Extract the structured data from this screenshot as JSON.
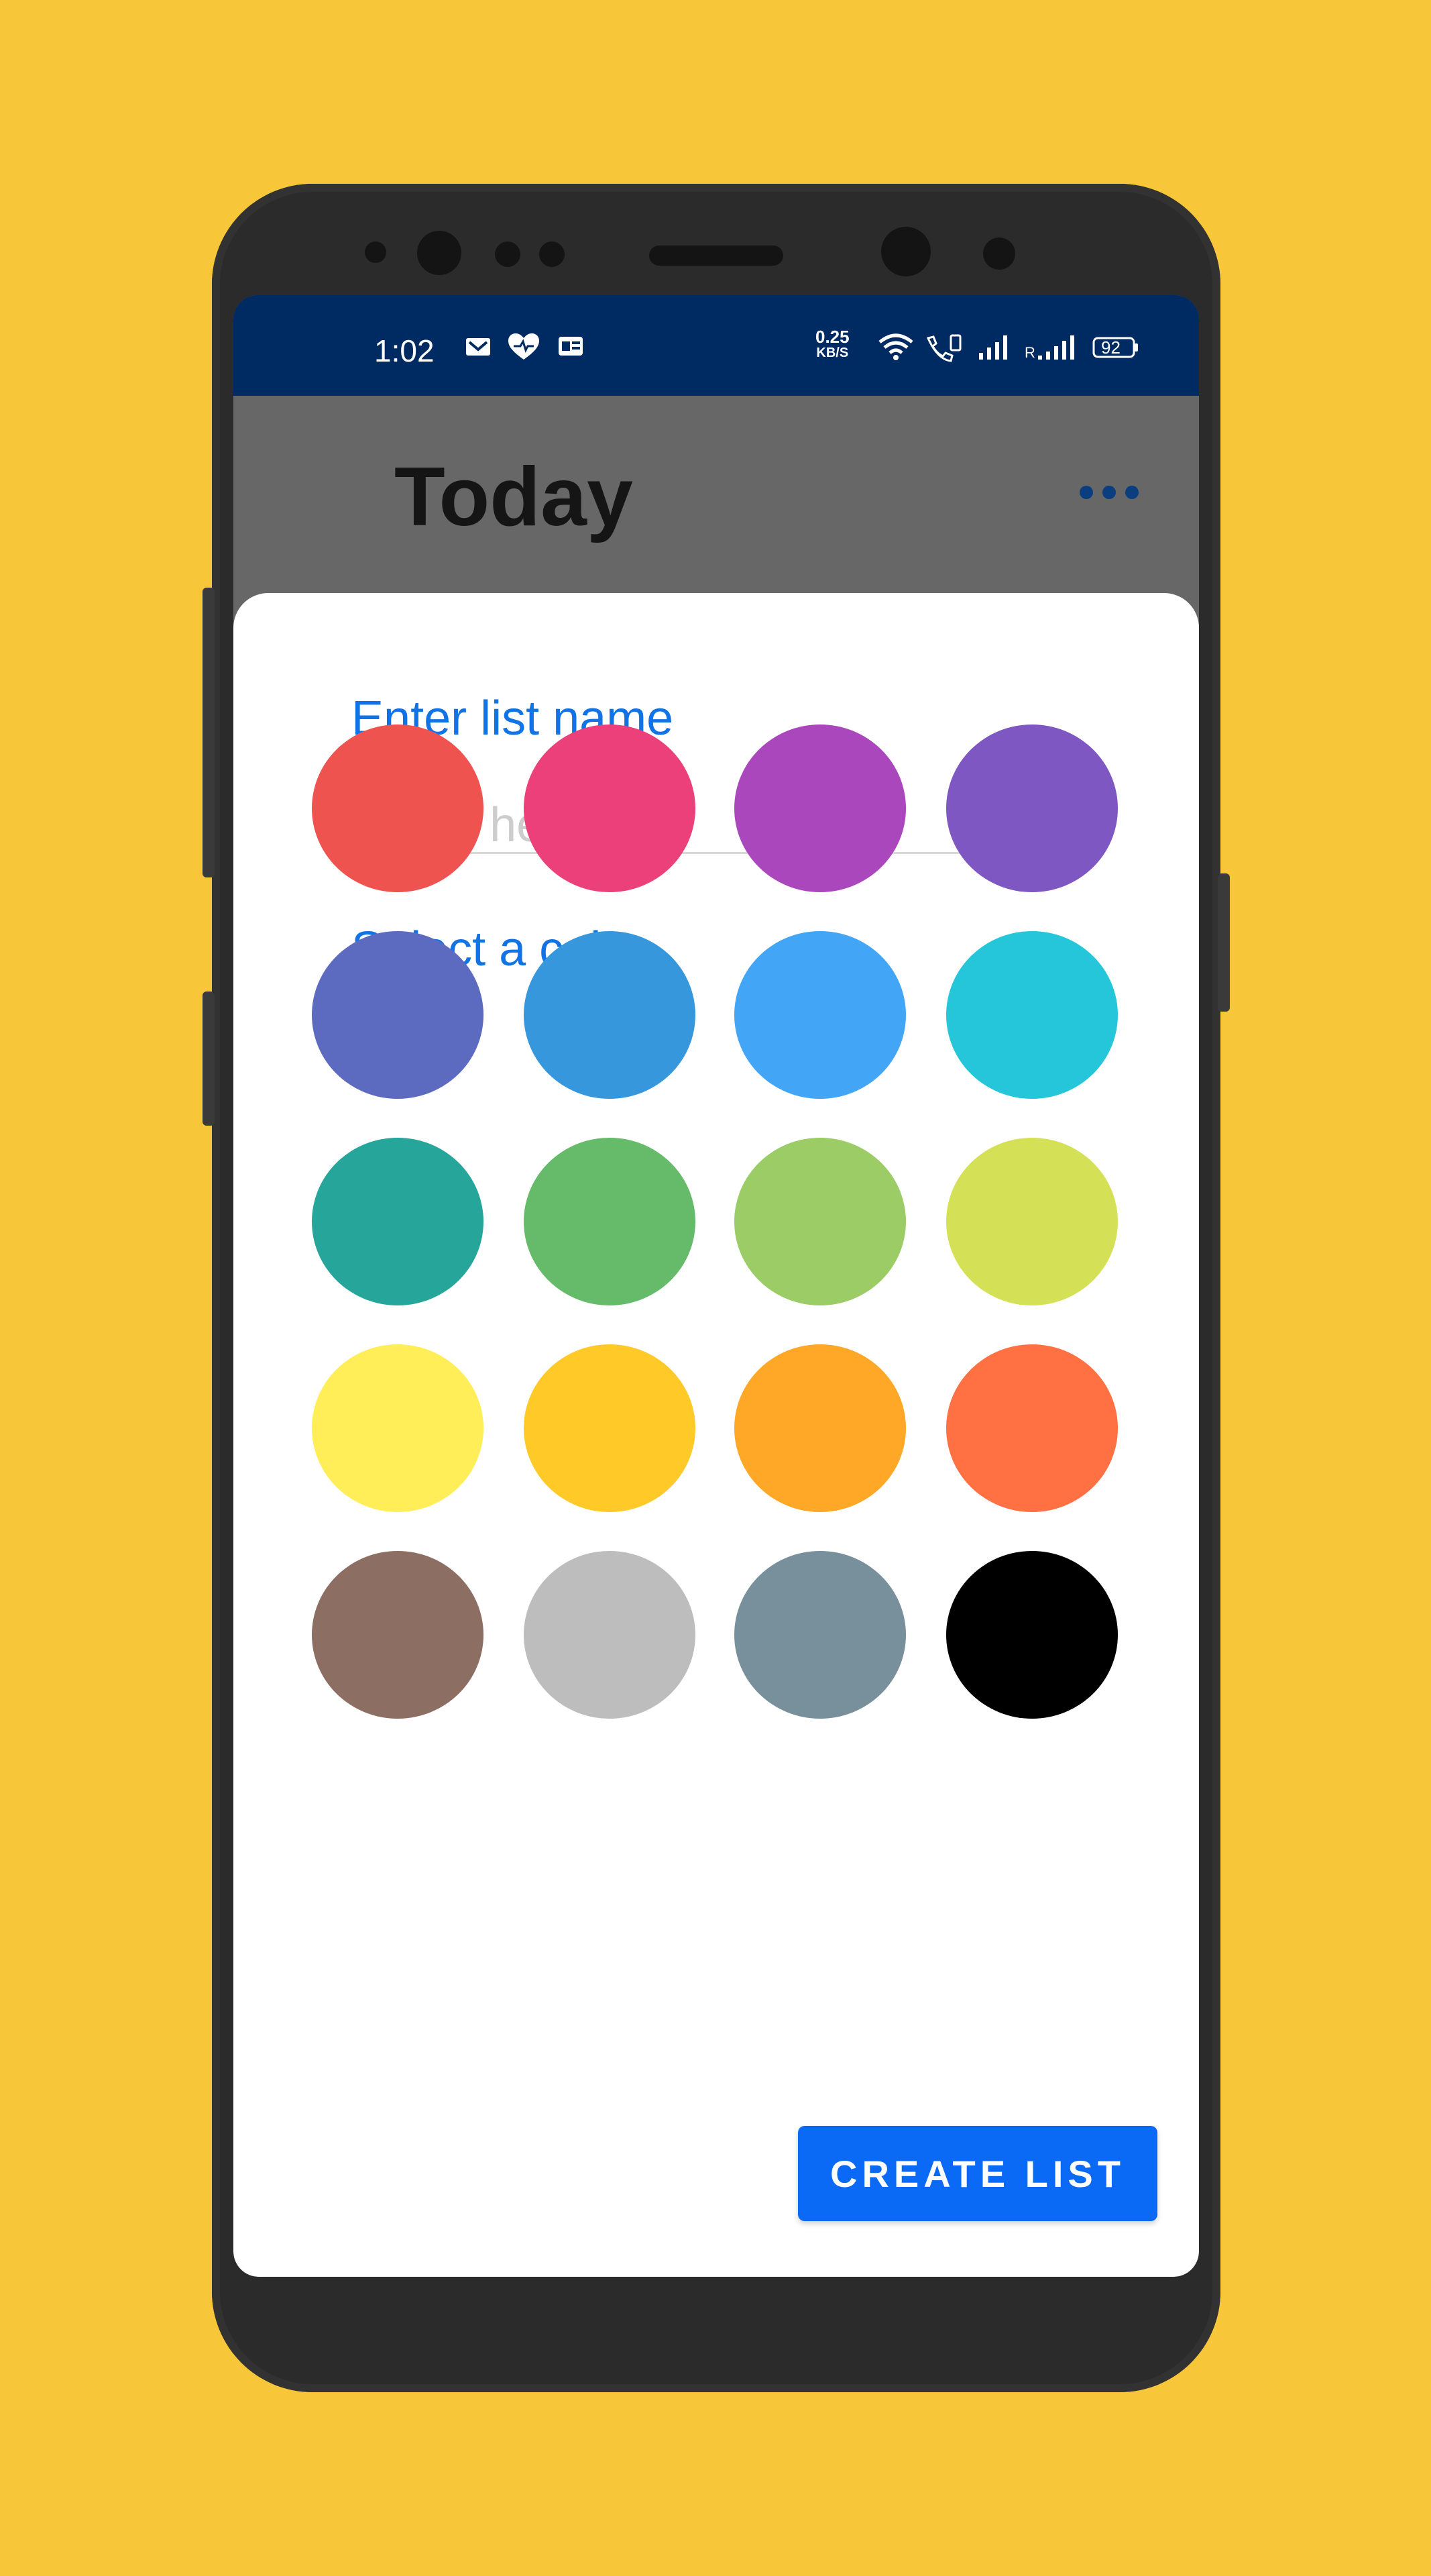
{
  "status_bar": {
    "time": "1:02",
    "net_speed_value": "0.25",
    "net_speed_unit": "KB/S",
    "roaming_indicator": "R",
    "battery": "92",
    "icons": [
      "mail-icon",
      "heart-icon",
      "gallery-icon",
      "wifi-icon",
      "volte-icon",
      "signal-icon",
      "signal-roaming-icon",
      "battery-icon"
    ]
  },
  "app_bar": {
    "title": "Today",
    "menu_icon": "more-horizontal-icon"
  },
  "dialog": {
    "list_name_label": "Enter list name",
    "list_name_placeholder": "Enter here",
    "list_name_value": "",
    "color_label": "Select a color",
    "colors": [
      "#EF5350",
      "#EC407A",
      "#AB47BC",
      "#7E57C2",
      "#5C6BC0",
      "#3697DD",
      "#42A5F5",
      "#26C6DA",
      "#26A69A",
      "#66BB6A",
      "#9CCC65",
      "#D4E157",
      "#FFEE58",
      "#FFCA28",
      "#FFA726",
      "#FF7043",
      "#8D6E63",
      "#BDBDBD",
      "#78909C",
      "#000000"
    ],
    "create_button": "CREATE LIST"
  },
  "theme": {
    "background": "#F7C739",
    "status_bar": "#002A62",
    "accent": "#1273E5",
    "button": "#0A6AF6"
  }
}
